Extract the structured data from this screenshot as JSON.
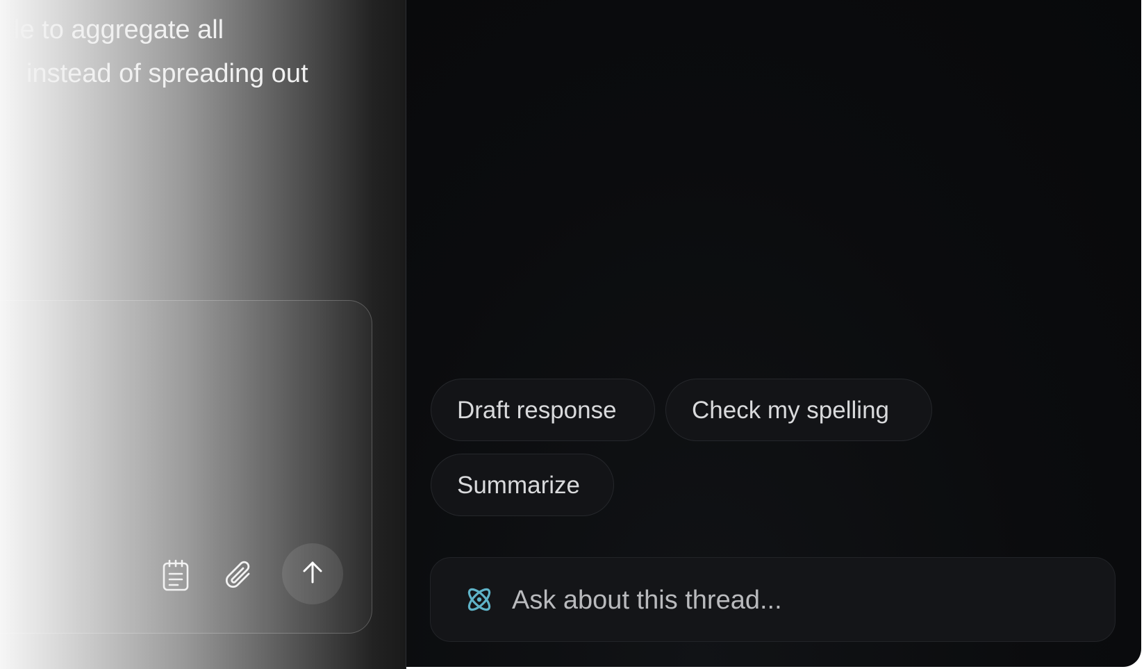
{
  "thread_preview": {
    "line1": "le to aggregate all",
    "line2": "instead of spreading out"
  },
  "composer": {
    "tools": [
      {
        "icon": "notepad-icon"
      },
      {
        "icon": "paperclip-icon"
      }
    ],
    "send_icon": "arrow-up-icon"
  },
  "assistant": {
    "suggestions": [
      {
        "label": "Draft response"
      },
      {
        "label": "Check my spelling"
      },
      {
        "label": "Summarize"
      }
    ],
    "ask": {
      "icon": "atom-icon",
      "placeholder": "Ask about this thread..."
    }
  },
  "colors": {
    "accent": "#5fb3c8",
    "panel_bg": "#0b0c0e",
    "chip_bg": "#131417",
    "chip_text": "#d9dadc"
  }
}
